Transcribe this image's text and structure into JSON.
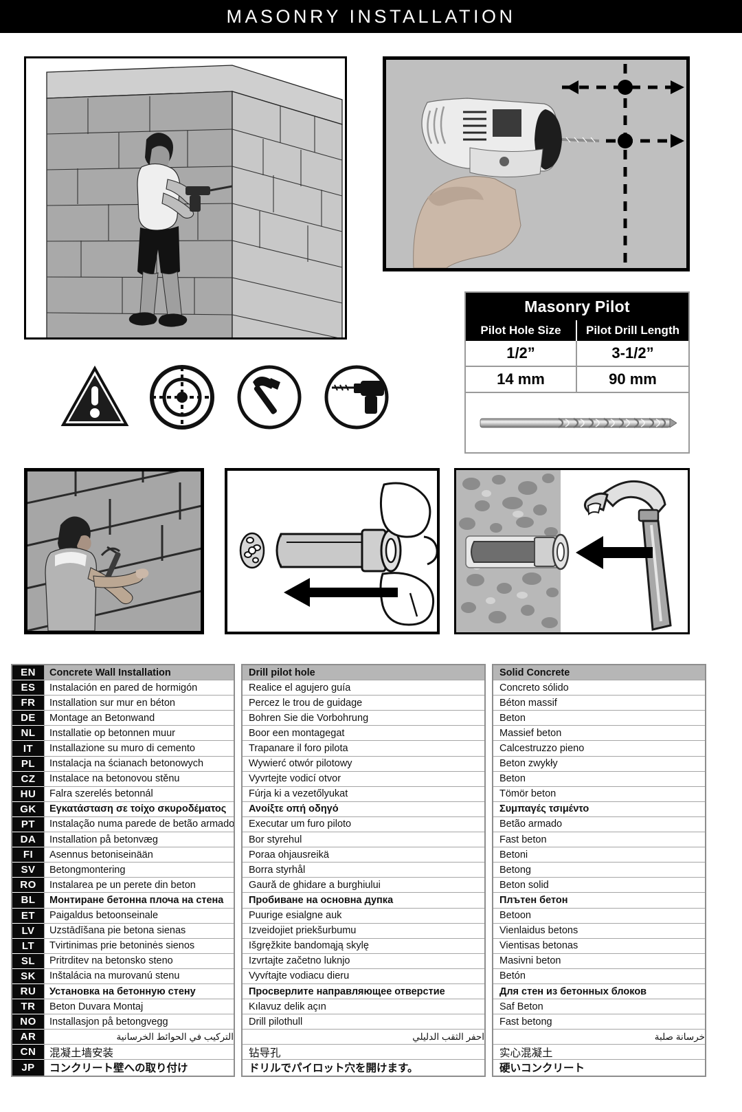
{
  "header": {
    "title": "MASONRY INSTALLATION"
  },
  "pilot_table": {
    "title": "Masonry Pilot",
    "columns": [
      "Pilot Hole Size",
      "Pilot Drill Length"
    ],
    "rows": [
      [
        "1/2”",
        "3-1/2”"
      ],
      [
        "14 mm",
        "90 mm"
      ]
    ],
    "illustration": "masonry-drill-bit"
  },
  "icons": [
    {
      "name": "warning-triangle-icon",
      "label": "Warning"
    },
    {
      "name": "crosshair-target-icon",
      "label": "Mark location"
    },
    {
      "name": "hammer-circle-icon",
      "label": "Hammer"
    },
    {
      "name": "drill-circle-icon",
      "label": "Drill"
    }
  ],
  "panels": [
    {
      "name": "wall-drilling-illustration",
      "caption": "Person drilling into concrete block wall"
    },
    {
      "name": "drill-crosshair-photo",
      "caption": "Hand holding drill aligned to crosshair"
    },
    {
      "name": "hammer-wall-photo",
      "caption": "Person hammering anchor into wall"
    },
    {
      "name": "anchor-insert-illustration",
      "caption": "Inserting anchor sleeve by hand"
    },
    {
      "name": "anchor-hammer-illustration",
      "caption": "Hammering anchor into concrete"
    }
  ],
  "language_table": {
    "codes": [
      "EN",
      "ES",
      "FR",
      "DE",
      "NL",
      "IT",
      "PL",
      "CZ",
      "HU",
      "GK",
      "PT",
      "DA",
      "FI",
      "SV",
      "RO",
      "BL",
      "ET",
      "LV",
      "LT",
      "SL",
      "SK",
      "RU",
      "TR",
      "NO",
      "AR",
      "CN",
      "JP"
    ],
    "column1": [
      "Concrete Wall Installation",
      "Instalación en pared de hormigón",
      "Installation sur mur en béton",
      "Montage an Betonwand",
      "Installatie op betonnen muur",
      "Installazione su muro di cemento",
      "Instalacja na ścianach betonowych",
      "Instalace na betonovou stěnu",
      "Falra szerelés betonnál",
      "Εγκατάσταση σε τοίχο σκυροδέματος",
      "Instalação numa parede de betão armado",
      "Installation på betonvæg",
      "Asennus betoniseinään",
      "Betongmontering",
      "Instalarea pe un perete din beton",
      "Монтиране бетонна плоча на стена",
      "Paigaldus betoonseinale",
      "Uzstādīšana pie betona sienas",
      "Tvirtinimas prie betoninės sienos",
      "Pritrditev na betonsko steno",
      "Inštalácia na murovanú stenu",
      "Установка на бетонную стену",
      "Beton Duvara Montaj",
      "Installasjon på betongvegg",
      "التركيب في الحوائط الخرسانية",
      "混凝土墙安装",
      "コンクリート壁への取り付け"
    ],
    "column2": [
      "Drill pilot hole",
      "Realice el agujero guía",
      "Percez le trou de guidage",
      "Bohren Sie die Vorbohrung",
      "Boor een montagegat",
      "Trapanare il foro pilota",
      "Wywierć otwór pilotowy",
      "Vyvrtejte vodicí otvor",
      "Fúrja ki a vezetőlyukat",
      "Ανοίξτε οπή οδηγό",
      "Executar um furo piloto",
      "Bor styrehul",
      "Poraa ohjausreikä",
      "Borra styrhål",
      "Gaură de ghidare a burghiului",
      "Пробиване на основна дупка",
      "Puurige esialgne auk",
      "Izveidojiet priekšurbumu",
      "Išgręžkite bandomąją skylę",
      "Izvrtajte začetno luknjo",
      "Vyvŕtajte vodiacu dieru",
      "Просверлите направляющее отверстие",
      "Kılavuz delik açın",
      "Drill pilothull",
      "احفر الثقب الدليلي",
      "钻导孔",
      "ドリルでパイロット穴を開けます。"
    ],
    "column3": [
      "Solid Concrete",
      "Concreto sólido",
      "Béton massif",
      "Beton",
      "Massief beton",
      "Calcestruzzo pieno",
      "Beton zwykły",
      "Beton",
      "Tömör beton",
      "Συμπαγές τσιμέντο",
      "Betão armado",
      "Fast beton",
      "Betoni",
      "Betong",
      "Beton solid",
      "Плътен бетон",
      "Betoon",
      "Vienlaidus betons",
      "Vientisas betonas",
      "Masivni beton",
      "Betón",
      "Для стен из бетонных блоков",
      "Saf Beton",
      "Fast betong",
      "خرسانة صلبة",
      "实心混凝土",
      "硬いコンクリート"
    ],
    "bold_row_codes": [
      "GK",
      "BL",
      "RU",
      "JP"
    ],
    "header_row_code": "EN"
  },
  "colors": {
    "header_bg": "#000000",
    "header_text": "#ffffff",
    "table_header_bg": "#b6b6b6",
    "code_bg": "#0a0a0a",
    "border": "#8d8d8d"
  }
}
